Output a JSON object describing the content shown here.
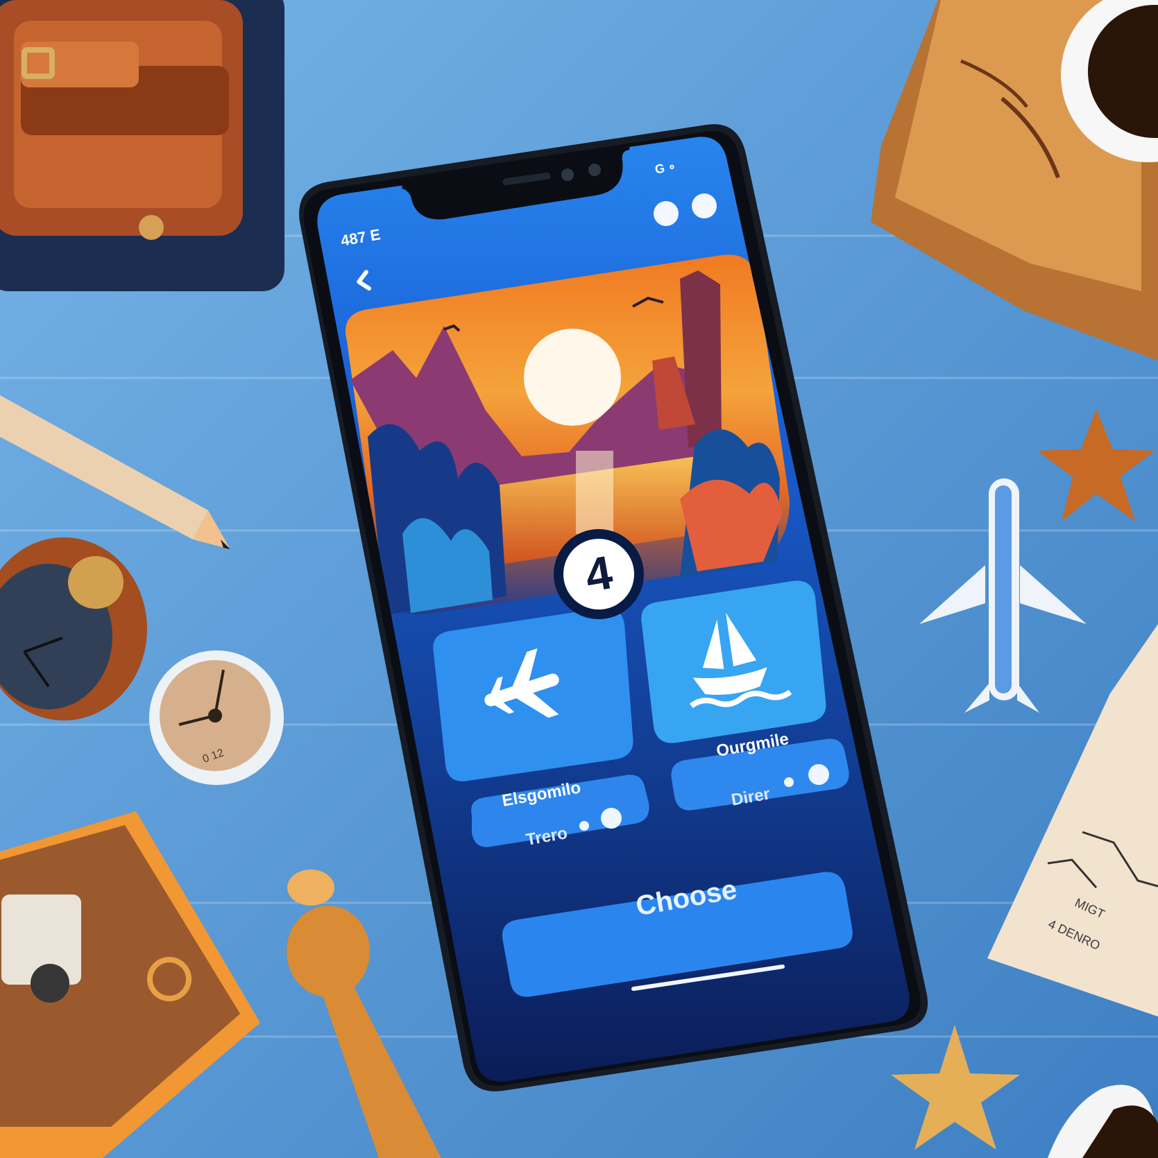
{
  "scene": {
    "background_color": "#4f8fcc",
    "phone_screen_color": "#0b1f57",
    "accent_blue": "#3d8ef2",
    "orange": "#f29a2e",
    "white": "#ffffff"
  },
  "phone": {
    "status_time": "487 E",
    "status_right": "G ∘",
    "step_number": "4",
    "left_option": {
      "label": "Elsgomilo",
      "pill_text": "Trero"
    },
    "right_option": {
      "label": "Ourgmile",
      "pill_text": "Direr"
    },
    "primary_button": "Choose"
  },
  "props": {
    "map_text_1": "MIGT",
    "map_text_2": "4 DENRO",
    "clock_text": "0 12"
  }
}
